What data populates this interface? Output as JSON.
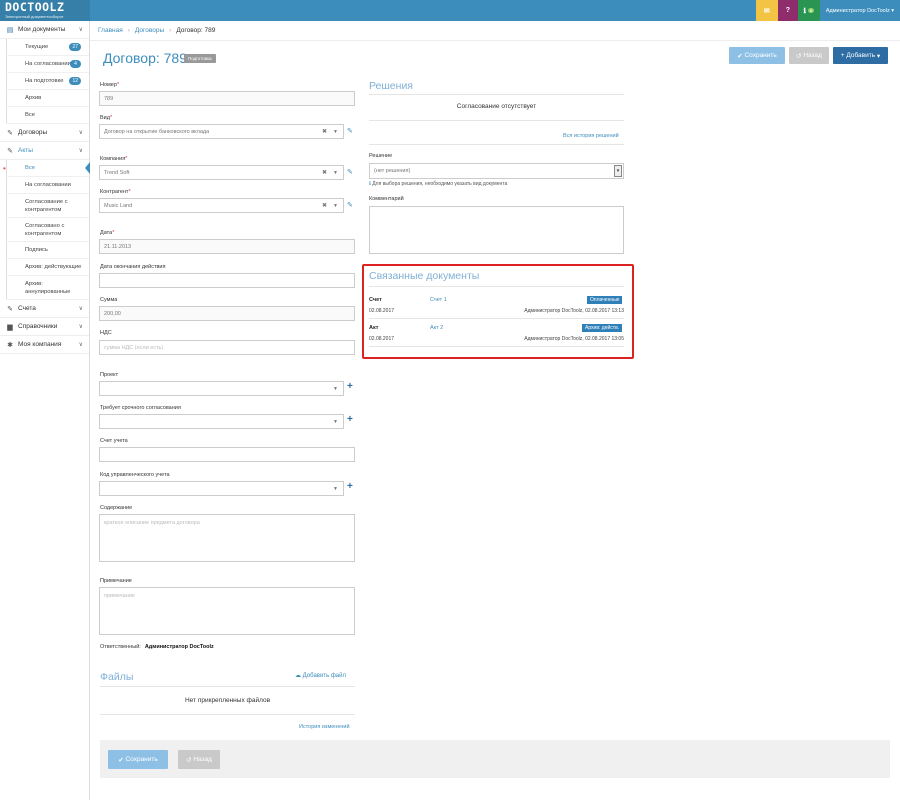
{
  "app": {
    "logo": "DOCTOOLZ",
    "tagline": "Электронный документооборот"
  },
  "topbar": {
    "mail_count": "",
    "info_badge": "0",
    "user_name": "Администратор DocToolz"
  },
  "sidebar": {
    "my_docs": "Мои документы",
    "my_docs_items": [
      {
        "label": "Текущие",
        "count": "27"
      },
      {
        "label": "На согласовании",
        "count": "4"
      },
      {
        "label": "На подготовке",
        "count": "12"
      },
      {
        "label": "Архив",
        "count": ""
      },
      {
        "label": "Все",
        "count": ""
      }
    ],
    "contracts": "Договоры",
    "acts": "Акты",
    "acts_items": [
      "Все",
      "На согласовании",
      "Согласование с контрагентом",
      "Согласовано с контрагентом",
      "Подпись",
      "Архив: действующие",
      "Архив: аннулированные"
    ],
    "invoices": "Счета",
    "references": "Справочники",
    "my_company": "Моя компания"
  },
  "breadcrumb": [
    "Главная",
    "Договоры",
    "Договор: 789"
  ],
  "header": {
    "title": "Договор: 789",
    "status": "Подготовка",
    "save": "Сохранить",
    "back": "Назад",
    "add": "Добавить"
  },
  "form": {
    "number_label": "Номер",
    "number_value": "789",
    "type_label": "Вид",
    "type_value": "Договор на открытие банковского вклада",
    "company_label": "Компания",
    "company_value": "Trend Soft",
    "counterparty_label": "Контрагент",
    "counterparty_value": "Music Land",
    "date_label": "Дата",
    "date_value": "21.11.2013",
    "end_date_label": "Дата окончания действия",
    "sum_label": "Сумма",
    "sum_value": "200,00",
    "vat_label": "НДС",
    "vat_placeholder": "сумма НДС (если есть)",
    "project_label": "Проект",
    "urgent_label": "Требует срочного согласования",
    "account_label": "Счет учета",
    "mgmt_code_label": "Код управленческого учета",
    "content_label": "Содержание",
    "content_placeholder": "краткое описание предмета договора",
    "note_label": "Примечание",
    "note_placeholder": "примечание",
    "responsible_label": "Ответственный:",
    "responsible_value": "Администратор DocToolz"
  },
  "files": {
    "title": "Файлы",
    "add": "Добавить файл",
    "empty": "Нет прикрепленных файлов",
    "history": "История изменений"
  },
  "decisions": {
    "title": "Решения",
    "empty": "Согласование отсутствует",
    "history": "Вся история решений",
    "decision_label": "Решение",
    "decision_value": "(нет решения)",
    "hint": "Для выбора решения, необходимо указать вид документа",
    "comment_label": "Комментарий"
  },
  "related": {
    "title": "Связанные документы",
    "rows": [
      {
        "type": "Счет",
        "name": "Счет 1",
        "date": "02.08.2017",
        "status": "Оплаченные",
        "meta": "Администратор DocToolz, 02.08.2017 13:13"
      },
      {
        "type": "Акт",
        "name": "Акт 2",
        "date": "02.08.2017",
        "status": "Архив: действ.",
        "meta": "Администратор DocToolz, 02.08.2017 13:05"
      }
    ]
  },
  "bottom": {
    "save": "Сохранить",
    "back": "Назад"
  }
}
